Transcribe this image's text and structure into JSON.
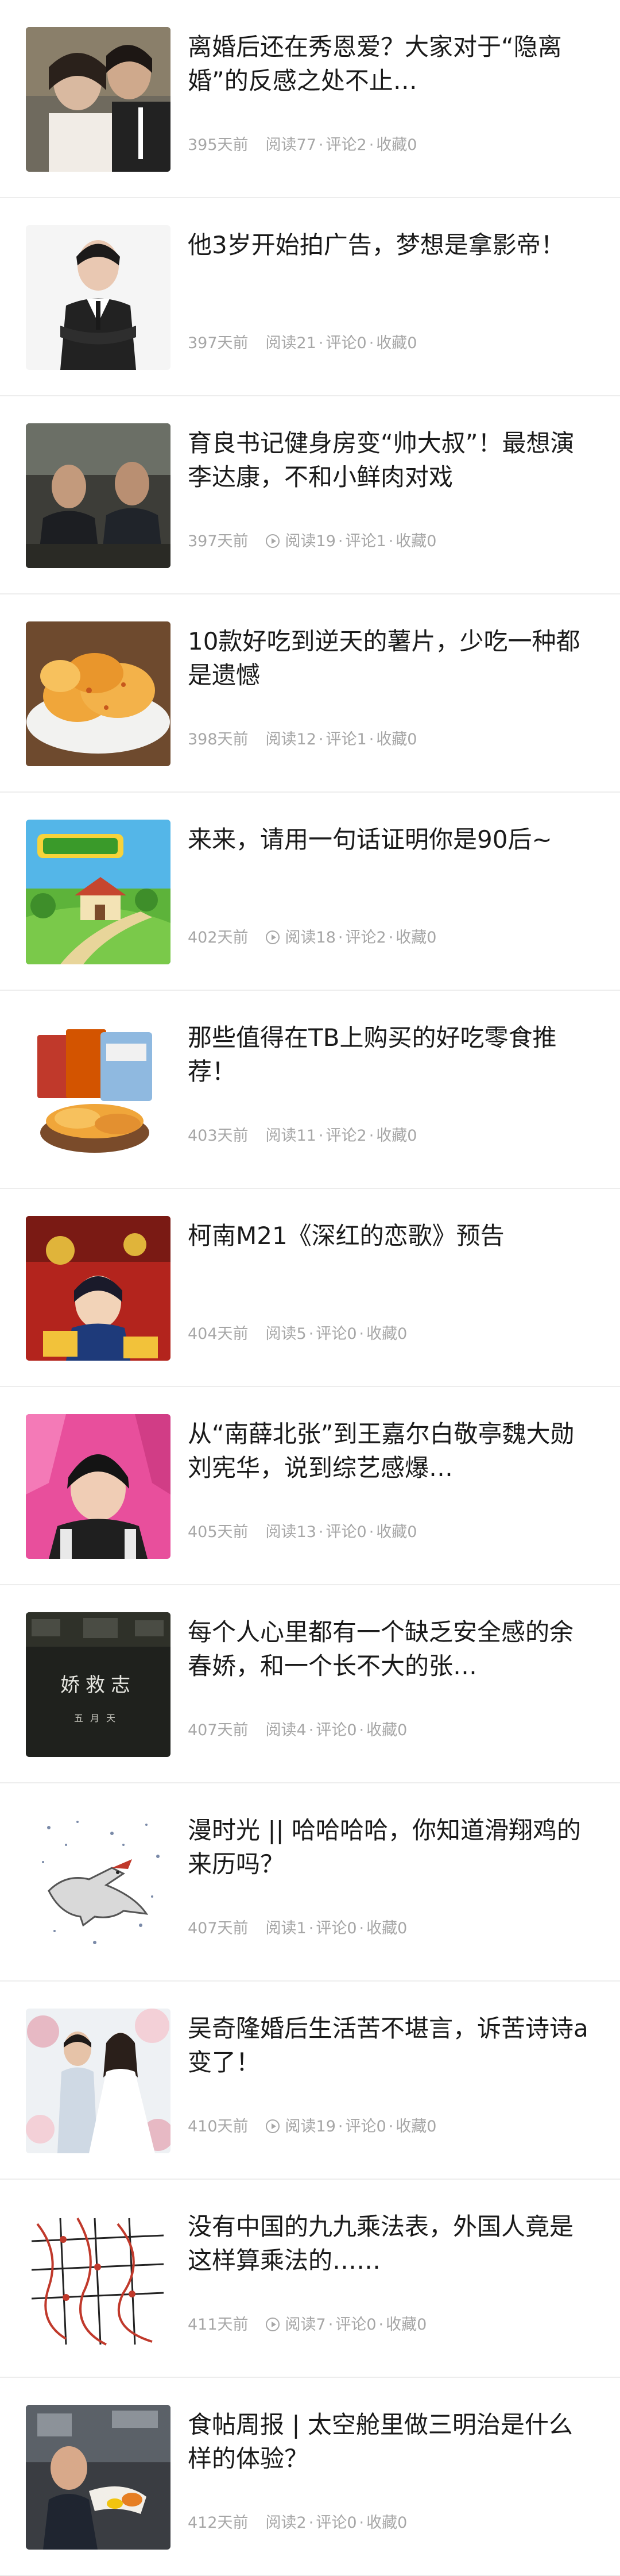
{
  "articles": [
    {
      "title": "离婚后还在秀恩爱？大家对于“隐离婚”的反感之处不止…",
      "time": "395天前",
      "reads": "阅读77",
      "comments": "评论2",
      "favorites": "收藏0",
      "video": false
    },
    {
      "title": "他3岁开始拍广告，梦想是拿影帝！",
      "time": "397天前",
      "reads": "阅读21",
      "comments": "评论0",
      "favorites": "收藏0",
      "video": false
    },
    {
      "title": "育良书记健身房变“帅大叔”！最想演李达康，不和小鲜肉对戏",
      "time": "397天前",
      "reads": "阅读19",
      "comments": "评论1",
      "favorites": "收藏0",
      "video": true
    },
    {
      "title": "10款好吃到逆天的薯片，少吃一种都是遗憾",
      "time": "398天前",
      "reads": "阅读12",
      "comments": "评论1",
      "favorites": "收藏0",
      "video": false
    },
    {
      "title": "来来，请用一句话证明你是90后~",
      "time": "402天前",
      "reads": "阅读18",
      "comments": "评论2",
      "favorites": "收藏0",
      "video": true
    },
    {
      "title": "那些值得在TB上购买的好吃零食推荐！",
      "time": "403天前",
      "reads": "阅读11",
      "comments": "评论2",
      "favorites": "收藏0",
      "video": false
    },
    {
      "title": "柯南M21《深红的恋歌》预告",
      "time": "404天前",
      "reads": "阅读5",
      "comments": "评论0",
      "favorites": "收藏0",
      "video": false
    },
    {
      "title": "从“南薛北张”到王嘉尔白敬亭魏大勋刘宪华，说到综艺感爆…",
      "time": "405天前",
      "reads": "阅读13",
      "comments": "评论0",
      "favorites": "收藏0",
      "video": false
    },
    {
      "title": "每个人心里都有一个缺乏安全感的余春娇，和一个长不大的张…",
      "time": "407天前",
      "reads": "阅读4",
      "comments": "评论0",
      "favorites": "收藏0",
      "video": false
    },
    {
      "title": "漫时光 || 哈哈哈哈，你知道滑翔鸡的来历吗？",
      "time": "407天前",
      "reads": "阅读1",
      "comments": "评论0",
      "favorites": "收藏0",
      "video": false
    },
    {
      "title": "吴奇隆婚后生活苦不堪言，诉苦诗诗a变了！",
      "time": "410天前",
      "reads": "阅读19",
      "comments": "评论0",
      "favorites": "收藏0",
      "video": true
    },
    {
      "title": "没有中国的九九乘法表，外国人竟是这样算乘法的……",
      "time": "411天前",
      "reads": "阅读7",
      "comments": "评论0",
      "favorites": "收藏0",
      "video": true
    },
    {
      "title": "食帖周报 | 太空舱里做三明治是什么样的体验？",
      "time": "412天前",
      "reads": "阅读2",
      "comments": "评论0",
      "favorites": "收藏0",
      "video": false
    }
  ],
  "thumbnails": {
    "8": {
      "poster_main": "娇救志",
      "poster_sub": "五月天"
    }
  },
  "colors": {
    "title": "#1a1a1a",
    "meta": "#a6a6a6",
    "divider": "#ededed"
  }
}
